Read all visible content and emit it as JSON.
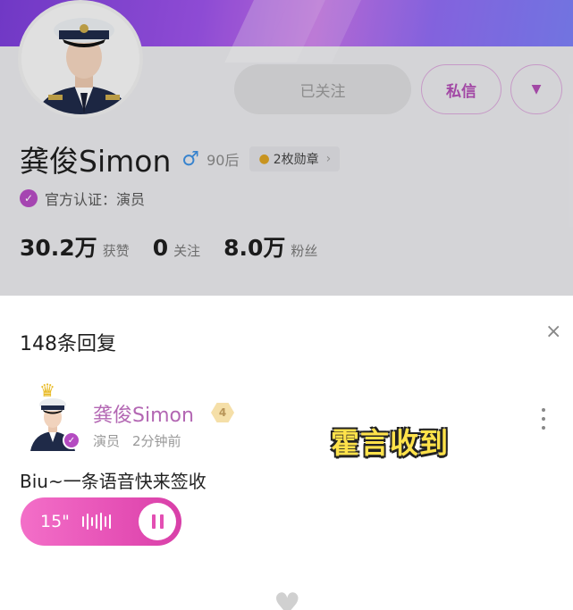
{
  "profile": {
    "name": "龚俊Simon",
    "gender_symbol": "♂",
    "age_group": "90后",
    "medals": "2枚勋章",
    "verify_label": "官方认证：演员",
    "stats": [
      {
        "value": "30.2万",
        "label": "获赞"
      },
      {
        "value": "0",
        "label": "关注"
      },
      {
        "value": "8.0万",
        "label": "粉丝"
      }
    ],
    "buttons": {
      "followed": "已关注",
      "message": "私信",
      "more_icon": "▼"
    }
  },
  "replies": {
    "count_title": "148条回复",
    "close_icon": "×",
    "comment": {
      "author": "龚俊Simon",
      "level": "4",
      "role": "演员",
      "time": "2分钟前",
      "text": "Biu~一条语音快来签收",
      "voice_duration": "15\""
    },
    "sticker_text": "霍言收到"
  },
  "colors": {
    "accent": "#b44bc1",
    "voice_pink": "#e651b6",
    "name_purple": "#b367b3"
  }
}
